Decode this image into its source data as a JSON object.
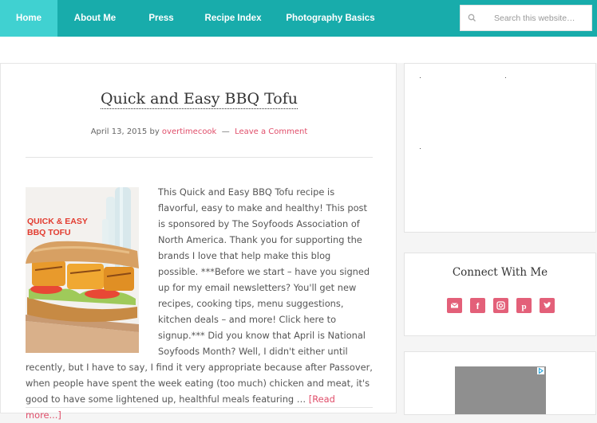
{
  "nav": {
    "items": [
      {
        "label": "Home",
        "active": true
      },
      {
        "label": "About Me"
      },
      {
        "label": "Press"
      },
      {
        "label": "Recipe Index"
      },
      {
        "label": "Photography Basics"
      }
    ],
    "search_placeholder": "Search this website…"
  },
  "post": {
    "title": "Quick and Easy BBQ Tofu",
    "date": "April 13, 2015",
    "by": "by",
    "author": "overtimecook",
    "dash": "—",
    "comments": "Leave a Comment",
    "image_caption": "QUICK & EASY\nBBQ TOFU",
    "excerpt": "This Quick and Easy BBQ Tofu recipe is flavorful, easy to make and healthy! This post is sponsored by The Soyfoods Association of North America. Thank you for supporting the brands I love that help make this blog possible. ***Before we start – have you signed up for my email newsletters? You'll get new recipes, cooking tips, menu suggestions, kitchen deals  – and more! Click here to signup.*** Did you know that April is National Soyfoods Month? Well, I didn't either until recently, but I have to say, I find it very appropriate because after Passover, when people have spent the week eating (too much) chicken and meat, it's good to have some lightened up, healthful meals featuring … ",
    "read_more": "[Read more...]"
  },
  "sidebar": {
    "connect_title": "Connect With Me",
    "social": [
      "email-icon",
      "facebook-icon",
      "instagram-icon",
      "pinterest-icon",
      "twitter-icon"
    ]
  },
  "colors": {
    "nav_bg": "#18acab",
    "nav_active": "#40d1d1",
    "accent_link": "#e04e6a",
    "social_bg": "#e36079"
  }
}
